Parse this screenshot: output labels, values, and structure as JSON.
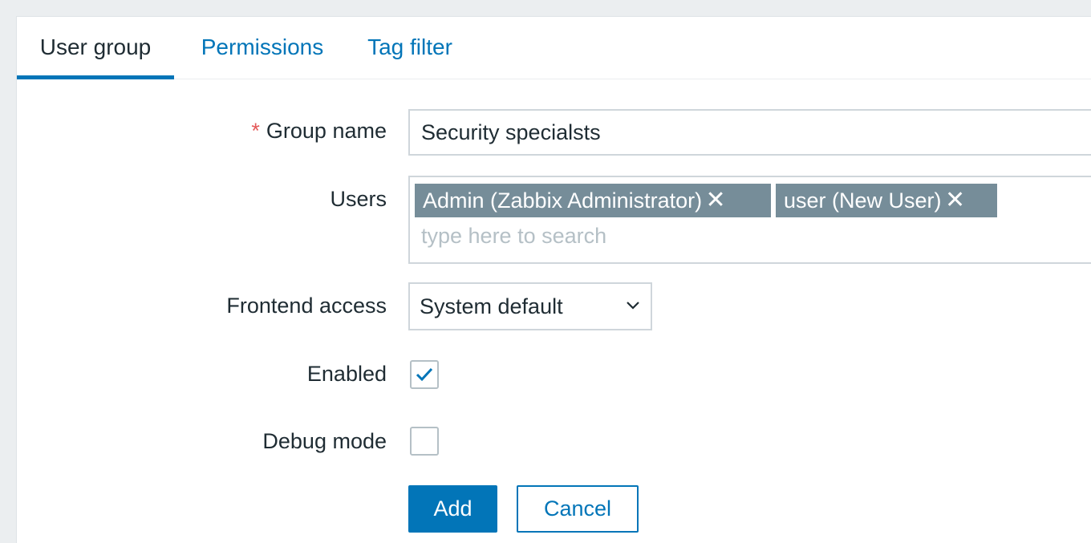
{
  "tabs": [
    {
      "label": "User group",
      "active": true
    },
    {
      "label": "Permissions",
      "active": false
    },
    {
      "label": "Tag filter",
      "active": false
    }
  ],
  "form": {
    "group_name": {
      "required_marker": "*",
      "label": "Group name",
      "value": "Security specialsts"
    },
    "users": {
      "label": "Users",
      "selected": [
        {
          "label": "Admin (Zabbix Administrator)",
          "remove_icon": "close-icon"
        },
        {
          "label": "user (New User)",
          "remove_icon": "close-icon"
        }
      ],
      "placeholder": "type here to search"
    },
    "frontend_access": {
      "label": "Frontend access",
      "value": "System default"
    },
    "enabled": {
      "label": "Enabled",
      "checked": true
    },
    "debug_mode": {
      "label": "Debug mode",
      "checked": false
    }
  },
  "buttons": {
    "add": "Add",
    "cancel": "Cancel"
  },
  "colors": {
    "accent": "#0275b8",
    "chip_bg": "#768d99",
    "required": "#e45959",
    "page_bg": "#ebeef0"
  }
}
